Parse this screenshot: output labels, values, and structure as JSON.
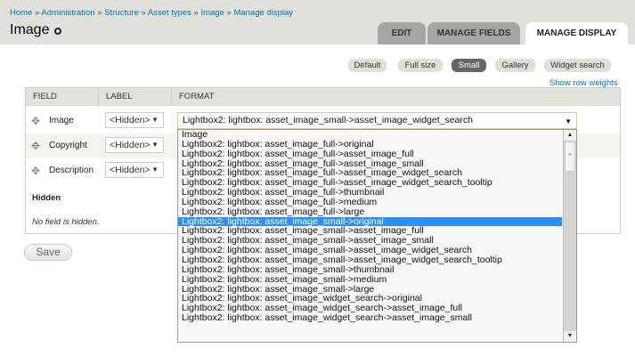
{
  "breadcrumb": [
    "Home",
    "Administration",
    "Structure",
    "Asset types",
    "Image",
    "Manage display"
  ],
  "breadcrumb_sep": "»",
  "title": "Image",
  "tabs": [
    {
      "label": "EDIT"
    },
    {
      "label": "MANAGE FIELDS"
    },
    {
      "label": "MANAGE DISPLAY",
      "active": true
    }
  ],
  "view_modes": [
    {
      "label": "Default"
    },
    {
      "label": "Full size"
    },
    {
      "label": "Small",
      "active": true
    },
    {
      "label": "Gallery"
    },
    {
      "label": "Widget search"
    }
  ],
  "show_row_weights": "Show row weights",
  "table": {
    "headers": [
      "FIELD",
      "LABEL",
      "FORMAT"
    ],
    "rows": [
      {
        "field": "Image",
        "label": "<Hidden>",
        "format": "Lightbox2: lightbox: asset_image_small->asset_image_widget_search"
      },
      {
        "field": "Copyright",
        "label": "<Hidden>"
      },
      {
        "field": "Description",
        "label": "<Hidden>"
      }
    ],
    "hidden_heading": "Hidden",
    "no_field_hidden": "No field is hidden."
  },
  "save_label": "Save",
  "dropdown": {
    "selected_index": 9,
    "options": [
      "Image",
      "Lightbox2: lightbox: asset_image_full->original",
      "Lightbox2: lightbox: asset_image_full->asset_image_full",
      "Lightbox2: lightbox: asset_image_full->asset_image_small",
      "Lightbox2: lightbox: asset_image_full->asset_image_widget_search",
      "Lightbox2: lightbox: asset_image_full->asset_image_widget_search_tooltip",
      "Lightbox2: lightbox: asset_image_full->thumbnail",
      "Lightbox2: lightbox: asset_image_full->medium",
      "Lightbox2: lightbox: asset_image_full->large",
      "Lightbox2: lightbox: asset_image_small->original",
      "Lightbox2: lightbox: asset_image_small->asset_image_full",
      "Lightbox2: lightbox: asset_image_small->asset_image_small",
      "Lightbox2: lightbox: asset_image_small->asset_image_widget_search",
      "Lightbox2: lightbox: asset_image_small->asset_image_widget_search_tooltip",
      "Lightbox2: lightbox: asset_image_small->thumbnail",
      "Lightbox2: lightbox: asset_image_small->medium",
      "Lightbox2: lightbox: asset_image_small->large",
      "Lightbox2: lightbox: asset_image_widget_search->original",
      "Lightbox2: lightbox: asset_image_widget_search->asset_image_full",
      "Lightbox2: lightbox: asset_image_widget_search->asset_image_small"
    ]
  }
}
